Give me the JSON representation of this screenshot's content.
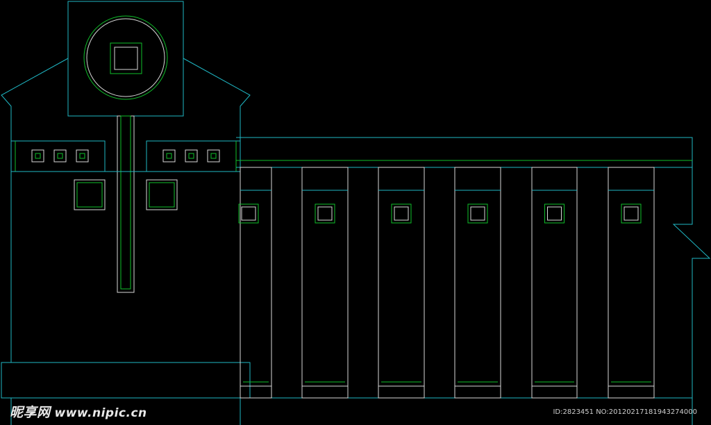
{
  "watermark": {
    "brand": "昵享网",
    "url": "www.nipic.cn",
    "id_text": "ID:2823451 NO:20120217181943274000"
  },
  "colors": {
    "background": "#000000",
    "outline_cyan": "#1fb7c4",
    "outline_green": "#0fbf2a",
    "outline_white": "#d8d8d8"
  }
}
